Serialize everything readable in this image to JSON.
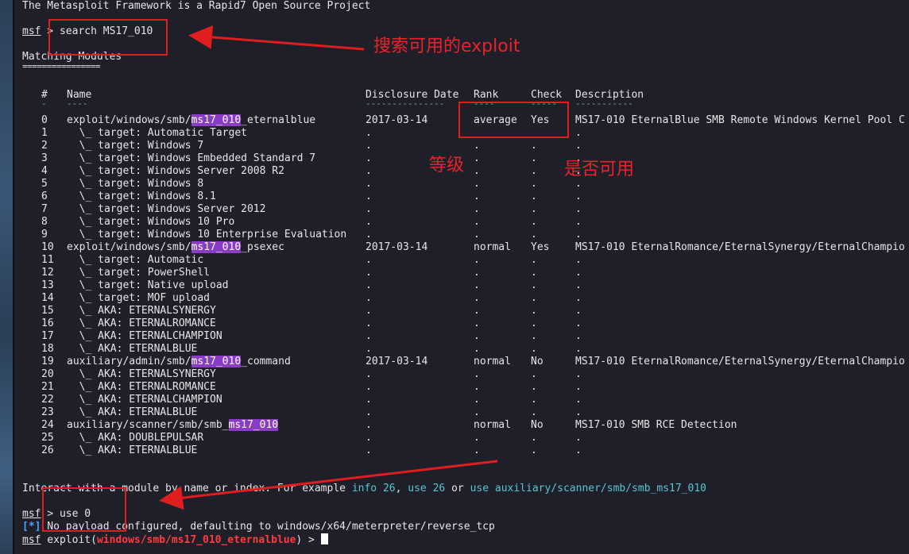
{
  "banner": "The Metasploit Framework is a Rapid7 Open Source Project",
  "prompt1": {
    "prompt": "msf",
    "sep": " > ",
    "command": "search MS17_010"
  },
  "matching_title": "Matching Modules",
  "matching_underline": "================",
  "headers": {
    "num": "#",
    "name": "Name",
    "date": "Disclosure Date",
    "rank": "Rank",
    "check": "Check",
    "desc": "Description"
  },
  "header_underlines": {
    "num": "-",
    "name": "----",
    "date": "---------------",
    "rank": "----",
    "check": "-----",
    "desc": "-----------"
  },
  "rows": [
    {
      "n": "0",
      "pre": "exploit/windows/smb/",
      "hl": "ms17_010",
      "post": "_eternalblue",
      "date": "2017-03-14",
      "rank": "average",
      "check": "Yes",
      "desc": "MS17-010 EternalBlue SMB Remote Windows Kernel Pool C"
    },
    {
      "n": "1",
      "pre": "  \\_ target: Automatic Target",
      "hl": "",
      "post": "",
      "date": ".",
      "rank": "",
      "check": "",
      "desc": "."
    },
    {
      "n": "2",
      "pre": "  \\_ target: Windows 7",
      "hl": "",
      "post": "",
      "date": ".",
      "rank": ".",
      "check": ".",
      "desc": "."
    },
    {
      "n": "3",
      "pre": "  \\_ target: Windows Embedded Standard 7",
      "hl": "",
      "post": "",
      "date": ".",
      "rank": ".",
      "check": ".",
      "desc": "."
    },
    {
      "n": "4",
      "pre": "  \\_ target: Windows Server 2008 R2",
      "hl": "",
      "post": "",
      "date": ".",
      "rank": ".",
      "check": ".",
      "desc": "."
    },
    {
      "n": "5",
      "pre": "  \\_ target: Windows 8",
      "hl": "",
      "post": "",
      "date": ".",
      "rank": ".",
      "check": ".",
      "desc": "."
    },
    {
      "n": "6",
      "pre": "  \\_ target: Windows 8.1",
      "hl": "",
      "post": "",
      "date": ".",
      "rank": ".",
      "check": ".",
      "desc": "."
    },
    {
      "n": "7",
      "pre": "  \\_ target: Windows Server 2012",
      "hl": "",
      "post": "",
      "date": ".",
      "rank": ".",
      "check": ".",
      "desc": "."
    },
    {
      "n": "8",
      "pre": "  \\_ target: Windows 10 Pro",
      "hl": "",
      "post": "",
      "date": ".",
      "rank": ".",
      "check": ".",
      "desc": "."
    },
    {
      "n": "9",
      "pre": "  \\_ target: Windows 10 Enterprise Evaluation",
      "hl": "",
      "post": "",
      "date": ".",
      "rank": ".",
      "check": ".",
      "desc": "."
    },
    {
      "n": "10",
      "pre": "exploit/windows/smb/",
      "hl": "ms17_010",
      "post": "_psexec",
      "date": "2017-03-14",
      "rank": "normal",
      "check": "Yes",
      "desc": "MS17-010 EternalRomance/EternalSynergy/EternalChampio"
    },
    {
      "n": "11",
      "pre": "  \\_ target: Automatic",
      "hl": "",
      "post": "",
      "date": ".",
      "rank": ".",
      "check": ".",
      "desc": "."
    },
    {
      "n": "12",
      "pre": "  \\_ target: PowerShell",
      "hl": "",
      "post": "",
      "date": ".",
      "rank": ".",
      "check": ".",
      "desc": "."
    },
    {
      "n": "13",
      "pre": "  \\_ target: Native upload",
      "hl": "",
      "post": "",
      "date": ".",
      "rank": ".",
      "check": ".",
      "desc": "."
    },
    {
      "n": "14",
      "pre": "  \\_ target: MOF upload",
      "hl": "",
      "post": "",
      "date": ".",
      "rank": ".",
      "check": ".",
      "desc": "."
    },
    {
      "n": "15",
      "pre": "  \\_ AKA: ETERNALSYNERGY",
      "hl": "",
      "post": "",
      "date": ".",
      "rank": ".",
      "check": ".",
      "desc": "."
    },
    {
      "n": "16",
      "pre": "  \\_ AKA: ETERNALROMANCE",
      "hl": "",
      "post": "",
      "date": ".",
      "rank": ".",
      "check": ".",
      "desc": "."
    },
    {
      "n": "17",
      "pre": "  \\_ AKA: ETERNALCHAMPION",
      "hl": "",
      "post": "",
      "date": ".",
      "rank": ".",
      "check": ".",
      "desc": "."
    },
    {
      "n": "18",
      "pre": "  \\_ AKA: ETERNALBLUE",
      "hl": "",
      "post": "",
      "date": ".",
      "rank": ".",
      "check": ".",
      "desc": "."
    },
    {
      "n": "19",
      "pre": "auxiliary/admin/smb/",
      "hl": "ms17_010",
      "post": "_command",
      "date": "2017-03-14",
      "rank": "normal",
      "check": "No",
      "desc": "MS17-010 EternalRomance/EternalSynergy/EternalChampio"
    },
    {
      "n": "20",
      "pre": "  \\_ AKA: ETERNALSYNERGY",
      "hl": "",
      "post": "",
      "date": ".",
      "rank": ".",
      "check": ".",
      "desc": "."
    },
    {
      "n": "21",
      "pre": "  \\_ AKA: ETERNALROMANCE",
      "hl": "",
      "post": "",
      "date": ".",
      "rank": ".",
      "check": ".",
      "desc": "."
    },
    {
      "n": "22",
      "pre": "  \\_ AKA: ETERNALCHAMPION",
      "hl": "",
      "post": "",
      "date": ".",
      "rank": ".",
      "check": ".",
      "desc": "."
    },
    {
      "n": "23",
      "pre": "  \\_ AKA: ETERNALBLUE",
      "hl": "",
      "post": "",
      "date": ".",
      "rank": ".",
      "check": ".",
      "desc": "."
    },
    {
      "n": "24",
      "pre": "auxiliary/scanner/smb/smb_",
      "hl": "ms17_010",
      "post": "",
      "date": ".",
      "rank": "normal",
      "check": "No",
      "desc": "MS17-010 SMB RCE Detection"
    },
    {
      "n": "25",
      "pre": "  \\_ AKA: DOUBLEPULSAR",
      "hl": "",
      "post": "",
      "date": ".",
      "rank": ".",
      "check": ".",
      "desc": "."
    },
    {
      "n": "26",
      "pre": "  \\_ AKA: ETERNALBLUE",
      "hl": "",
      "post": "",
      "date": ".",
      "rank": ".",
      "check": ".",
      "desc": "."
    }
  ],
  "interact": {
    "pre": "Interact with a module by name or index. For example ",
    "info": "info 26",
    "comma": ", ",
    "use": "use 26",
    "or": " or ",
    "use_path": "use auxiliary/scanner/smb/smb_ms17_010"
  },
  "prompt2": {
    "prompt": "msf",
    "sep": " > ",
    "command": "use 0"
  },
  "info_line": {
    "marker": "[*]",
    "text": " No payload configured, defaulting to windows/x64/meterpreter/reverse_tcp"
  },
  "prompt3": {
    "prompt": "msf",
    "mid": " exploit(",
    "module": "windows/smb/ms17_010_eternalblue",
    "end": ") > "
  },
  "annotations": {
    "search": "搜索可用的exploit",
    "rank": "等级",
    "check": "是否可用"
  },
  "colors": {
    "annotation": "#e01e1e",
    "highlight": "#8a3cc4",
    "link": "#57c7d4"
  }
}
